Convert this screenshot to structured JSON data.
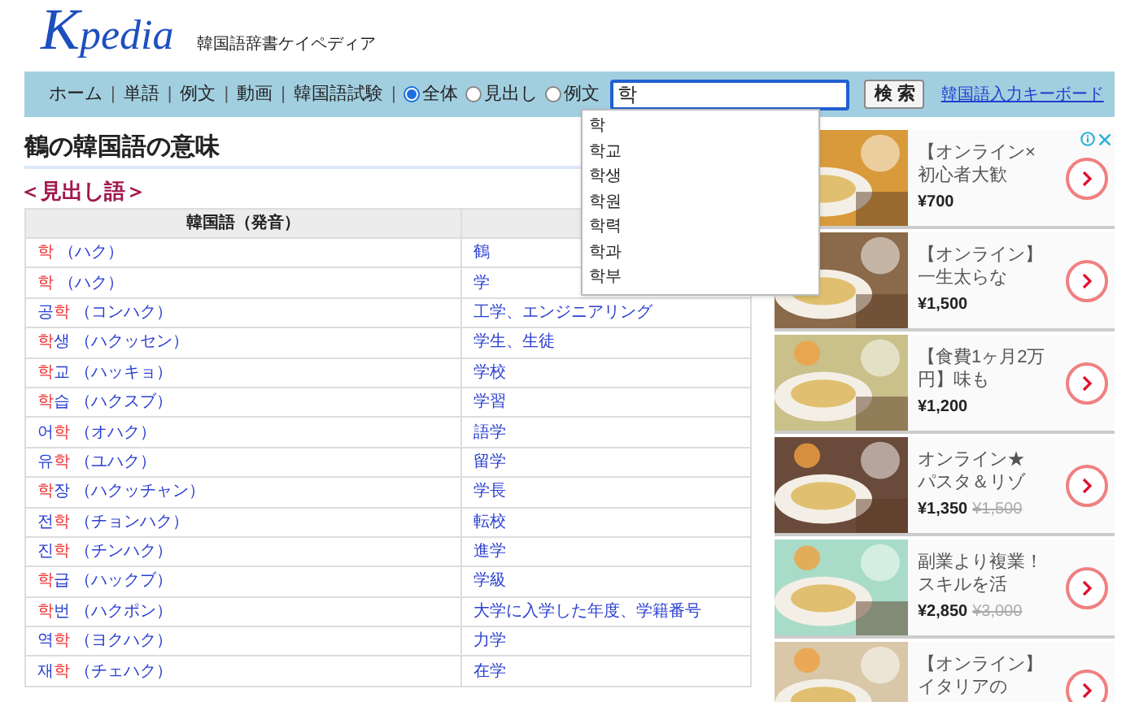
{
  "logo": {
    "text": "Kpedia",
    "subtitle": "韓国語辞書ケイペディア"
  },
  "nav": {
    "items": [
      "ホーム",
      "単語",
      "例文",
      "動画",
      "韓国語試験"
    ],
    "separator": "|",
    "scopes": [
      {
        "label": "全体",
        "selected": true
      },
      {
        "label": "見出し",
        "selected": false
      },
      {
        "label": "例文",
        "selected": false
      }
    ],
    "search": {
      "value": "학",
      "button": "検 索"
    },
    "keyboard_link": "韓国語入力キーボード",
    "suggestions": [
      "학",
      "학교",
      "학생",
      "학원",
      "학력",
      "학과",
      "학부"
    ]
  },
  "page_title": "鶴の韓国語の意味",
  "section_heading": "＜見出し語＞",
  "table": {
    "columns": [
      "韓国語（発音）"
    ],
    "rows": [
      {
        "word": [
          {
            "text": "학",
            "hit": true
          }
        ],
        "reading": "（ハク）",
        "meaning": "鶴"
      },
      {
        "word": [
          {
            "text": "학",
            "hit": true
          }
        ],
        "reading": "（ハク）",
        "meaning": "学"
      },
      {
        "word": [
          {
            "text": "공",
            "hit": false
          },
          {
            "text": "학",
            "hit": true
          }
        ],
        "reading": "（コンハク）",
        "meaning": "工学、エンジニアリング"
      },
      {
        "word": [
          {
            "text": "학",
            "hit": true
          },
          {
            "text": "생",
            "hit": false
          }
        ],
        "reading": "（ハクッセン）",
        "meaning": "学生、生徒"
      },
      {
        "word": [
          {
            "text": "학",
            "hit": true
          },
          {
            "text": "교",
            "hit": false
          }
        ],
        "reading": "（ハッキョ）",
        "meaning": "学校"
      },
      {
        "word": [
          {
            "text": "학",
            "hit": true
          },
          {
            "text": "습",
            "hit": false
          }
        ],
        "reading": "（ハクスブ）",
        "meaning": "学習"
      },
      {
        "word": [
          {
            "text": "어",
            "hit": false
          },
          {
            "text": "학",
            "hit": true
          }
        ],
        "reading": "（オハク）",
        "meaning": "語学"
      },
      {
        "word": [
          {
            "text": "유",
            "hit": false
          },
          {
            "text": "학",
            "hit": true
          }
        ],
        "reading": "（ユハク）",
        "meaning": "留学"
      },
      {
        "word": [
          {
            "text": "학",
            "hit": true
          },
          {
            "text": "장",
            "hit": false
          }
        ],
        "reading": "（ハクッチャン）",
        "meaning": "学長"
      },
      {
        "word": [
          {
            "text": "전",
            "hit": false
          },
          {
            "text": "학",
            "hit": true
          }
        ],
        "reading": "（チョンハク）",
        "meaning": "転校"
      },
      {
        "word": [
          {
            "text": "진",
            "hit": false
          },
          {
            "text": "학",
            "hit": true
          }
        ],
        "reading": "（チンハク）",
        "meaning": "進学"
      },
      {
        "word": [
          {
            "text": "학",
            "hit": true
          },
          {
            "text": "급",
            "hit": false
          }
        ],
        "reading": "（ハックブ）",
        "meaning": "学級"
      },
      {
        "word": [
          {
            "text": "학",
            "hit": true
          },
          {
            "text": "번",
            "hit": false
          }
        ],
        "reading": "（ハクポン）",
        "meaning": "大学に入学した年度、学籍番号"
      },
      {
        "word": [
          {
            "text": "역",
            "hit": false
          },
          {
            "text": "학",
            "hit": true
          }
        ],
        "reading": "（ヨクハク）",
        "meaning": "力学"
      },
      {
        "word": [
          {
            "text": "재",
            "hit": false
          },
          {
            "text": "학",
            "hit": true
          }
        ],
        "reading": "（チェハク）",
        "meaning": "在学"
      }
    ]
  },
  "ads": [
    {
      "title_lines": [
        "【オンライン×",
        "初心者大歓"
      ],
      "price": "¥700"
    },
    {
      "title_lines": [
        "【オンライン】",
        "一生太らな"
      ],
      "price": "¥1,500"
    },
    {
      "title_lines": [
        "【食費1ヶ月2万",
        "円】味も"
      ],
      "price": "¥1,200"
    },
    {
      "title_lines": [
        "オンライン★",
        "パスタ＆リゾ"
      ],
      "price": "¥1,350",
      "old_price": "¥1,500"
    },
    {
      "title_lines": [
        "副業より複業！",
        "スキルを活"
      ],
      "price": "¥2,850",
      "old_price": "¥3,000"
    },
    {
      "title_lines": [
        "【オンライン】",
        "イタリアの"
      ]
    }
  ]
}
